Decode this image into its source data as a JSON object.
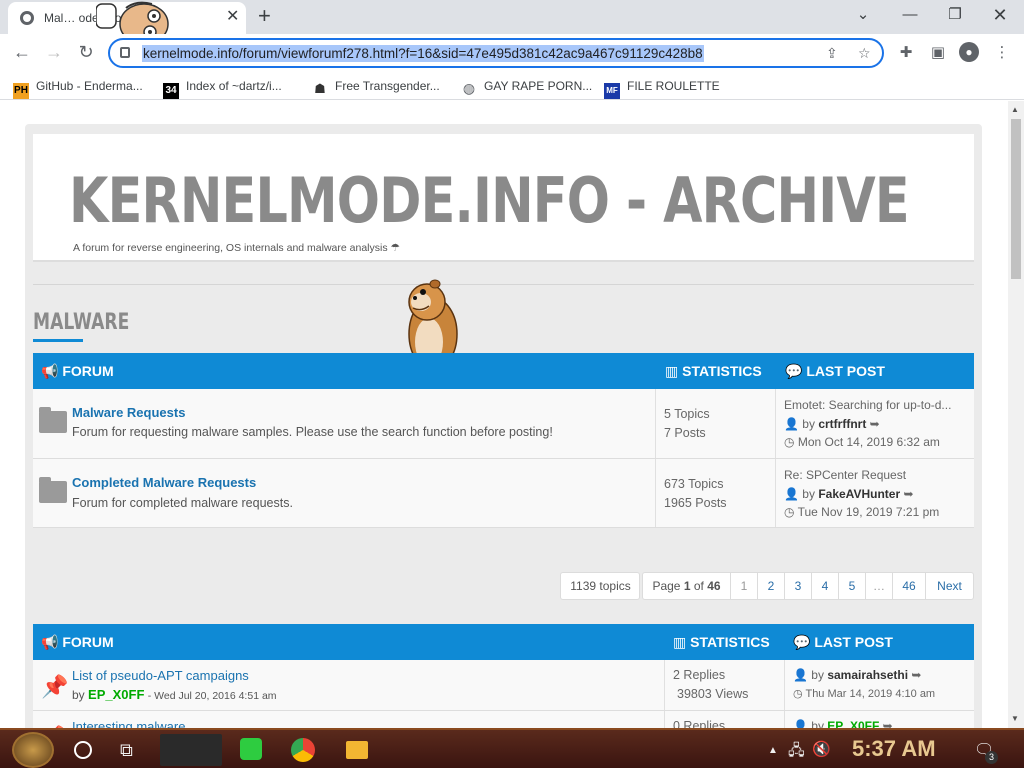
{
  "browser": {
    "tab_title": "Mal… ode.info",
    "url": "kernelmode.info/forum/viewforumf278.html?f=16&sid=47e495d381c42ac9a467c91129c428b8",
    "bookmarks": [
      {
        "label": "GitHub - Enderma...",
        "icon": "PH"
      },
      {
        "label": "Index of ~dartz/i...",
        "icon": "34"
      },
      {
        "label": "Free Transgender...",
        "icon": "pad-icon"
      },
      {
        "label": "GAY RAPE PORN...",
        "icon": "globe-icon"
      },
      {
        "label": "FILE ROULETTE",
        "icon": "MF"
      }
    ]
  },
  "site": {
    "title": "KERNELMODE.INFO - ARCHIVE",
    "description": "A forum for reverse engineering, OS internals and malware analysis"
  },
  "category": {
    "title": "MALWARE"
  },
  "forum_table": {
    "headers": {
      "forum": "FORUM",
      "statistics": "STATISTICS",
      "last_post": "LAST POST"
    },
    "rows": [
      {
        "name": "Malware Requests",
        "description": "Forum for requesting malware samples. Please use the search function before posting!",
        "topics": "5 Topics",
        "posts": "7 Posts",
        "last_title": "Emotet: Searching for up-to-d...",
        "by_label": "by",
        "last_author": "crtfrffnrt",
        "last_date": "Mon Oct 14, 2019 6:32 am"
      },
      {
        "name": "Completed Malware Requests",
        "description": "Forum for completed malware requests.",
        "topics": "673 Topics",
        "posts": "1965 Posts",
        "last_title": "Re: SPCenter Request",
        "by_label": "by",
        "last_author": "FakeAVHunter",
        "last_date": "Tue Nov 19, 2019 7:21 pm"
      }
    ]
  },
  "pagination": {
    "topics_count": "1139 topics",
    "page_prefix": "Page",
    "current": "1",
    "of_label": "of",
    "total": "46",
    "pages": [
      "1",
      "2",
      "3",
      "4",
      "5",
      "…",
      "46"
    ],
    "next": "Next"
  },
  "topic_table": {
    "headers": {
      "forum": "FORUM",
      "statistics": "STATISTICS",
      "last_post": "LAST POST"
    },
    "rows": [
      {
        "title": "List of pseudo-APT campaigns",
        "by_label": "by",
        "author": "EP_X0FF",
        "date": "- Wed Jul 20, 2016 4:51 am",
        "replies": "2 Replies",
        "views": "39803 Views",
        "last_author": "samairahsethi",
        "last_date": "Thu Mar 14, 2019 4:10 am"
      },
      {
        "title": "Interesting malware",
        "replies": "0 Replies",
        "last_author": "EP_X0FF"
      }
    ]
  },
  "taskbar": {
    "clock": "5:37 AM",
    "notification_count": "3"
  }
}
